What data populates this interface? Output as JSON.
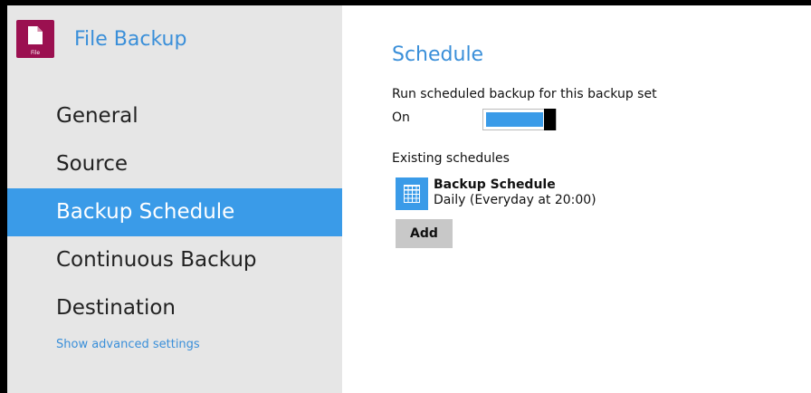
{
  "app": {
    "title": "File Backup",
    "icon_tag": "File",
    "icon_color": "#9b1050"
  },
  "sidebar": {
    "items": [
      {
        "label": "General",
        "active": false
      },
      {
        "label": "Source",
        "active": false
      },
      {
        "label": "Backup Schedule",
        "active": true
      },
      {
        "label": "Continuous Backup",
        "active": false
      },
      {
        "label": "Destination",
        "active": false
      }
    ],
    "advanced_link": "Show advanced settings"
  },
  "main": {
    "title": "Schedule",
    "run_label": "Run scheduled backup for this backup set",
    "toggle": {
      "state_label": "On",
      "on": true
    },
    "existing_label": "Existing schedules",
    "schedules": [
      {
        "name": "Backup Schedule",
        "description": "Daily (Everyday at 20:00)",
        "icon": "calendar-icon"
      }
    ],
    "add_label": "Add"
  },
  "colors": {
    "accent": "#3a9be8",
    "link": "#3a8fd9",
    "sidebar_bg": "#e6e6e6"
  }
}
